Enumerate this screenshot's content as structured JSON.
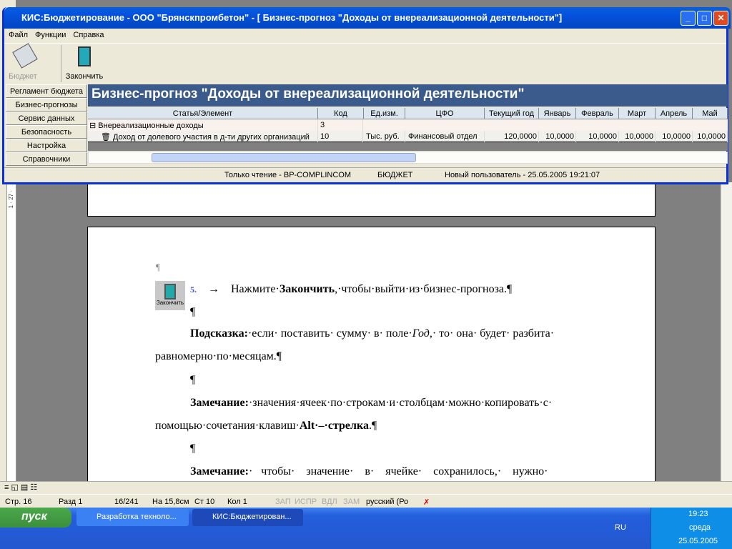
{
  "app": {
    "title": "КИС:Бюджетирование - ООО \"Брянскпромбетон\" - [ Бизнес-прогноз \"Доходы от внереализационной деятельности\"]",
    "menu": [
      "Файл",
      "Функции",
      "Справка"
    ],
    "toolbar": {
      "budget": "Бюджет",
      "finish": "Закончить"
    },
    "nav": [
      "Регламент бюджета",
      "Бизнес-прогнозы",
      "Сервис данных",
      "Безопасность",
      "Настройка",
      "Справочники"
    ],
    "header": "Бизнес-прогноз \"Доходы от внереализационной деятельности\"",
    "columns": [
      "Статья/Элемент",
      "Код",
      "Ед.изм.",
      "ЦФО",
      "Текущий год",
      "Январь",
      "Февраль",
      "Март",
      "Апрель",
      "Май"
    ],
    "rows": [
      {
        "name": "Внереализационные доходы",
        "code": "3",
        "unit": "",
        "cfo": "",
        "year": "",
        "m": [
          "",
          "",
          "",
          "",
          ""
        ]
      },
      {
        "name": "Доход от долевого участия в д-ти других организаций",
        "code": "10",
        "unit": "Тыс. руб.",
        "cfo": "Финансовый отдел",
        "year": "120,0000",
        "m": [
          "10,0000",
          "10,0000",
          "10,0000",
          "10,0000",
          "10,0000"
        ]
      }
    ],
    "status": {
      "readonly": "Только чтение - BP-COMPLINCOM",
      "module": "БЮДЖЕТ",
      "user": "Новый пользователь - 25.05.2005 19:21:07"
    }
  },
  "doc": {
    "ruler": "1 · 27 ·",
    "pilcrow": "¶",
    "icon_label": "Закончить",
    "step_num": "5.",
    "arrow": "→",
    "step_a": "Нажмите·",
    "step_b": "Закончить",
    "step_c": ",·чтобы·выйти·из·бизнес-прогноза.¶",
    "hint_b": "Подсказка:",
    "hint_a": "·если· поставить· сумму· в· поле·",
    "hint_i": "Год",
    "hint_c": ",· то· она· будет· разбита·",
    "hint2": "равномерно·по·месяцам.¶",
    "note_b": "Замечание:",
    "note_a": "·значения·ячеек·по·строкам·и·столбцам·можно·копировать·с·",
    "note2_a": "помощью·сочетания·клавиш·",
    "note2_b": "Alt·–·стрелка",
    ".": ".¶",
    "note3_b": "Замечание:",
    "note3_a": "·   чтобы·    значение·    в·    ячейке·    сохранилось,·    нужно·"
  },
  "word_status": {
    "page": "Стр. 16",
    "section": "Разд 1",
    "pages": "16/241",
    "at": "На 15,8см",
    "line": "Ст 10",
    "col": "Кол 1",
    "rec": "ЗАП",
    "trk": "ИСПР",
    "ext": "ВДЛ",
    "ovr": "ЗАМ",
    "lang": "русский (Ро"
  },
  "taskbar": {
    "start": "пуск",
    "tasks": [
      "Разработка техноло...",
      "КИС:Бюджетирован..."
    ],
    "lang": "RU",
    "time": "19:23",
    "day": "среда",
    "date": "25.05.2005"
  }
}
